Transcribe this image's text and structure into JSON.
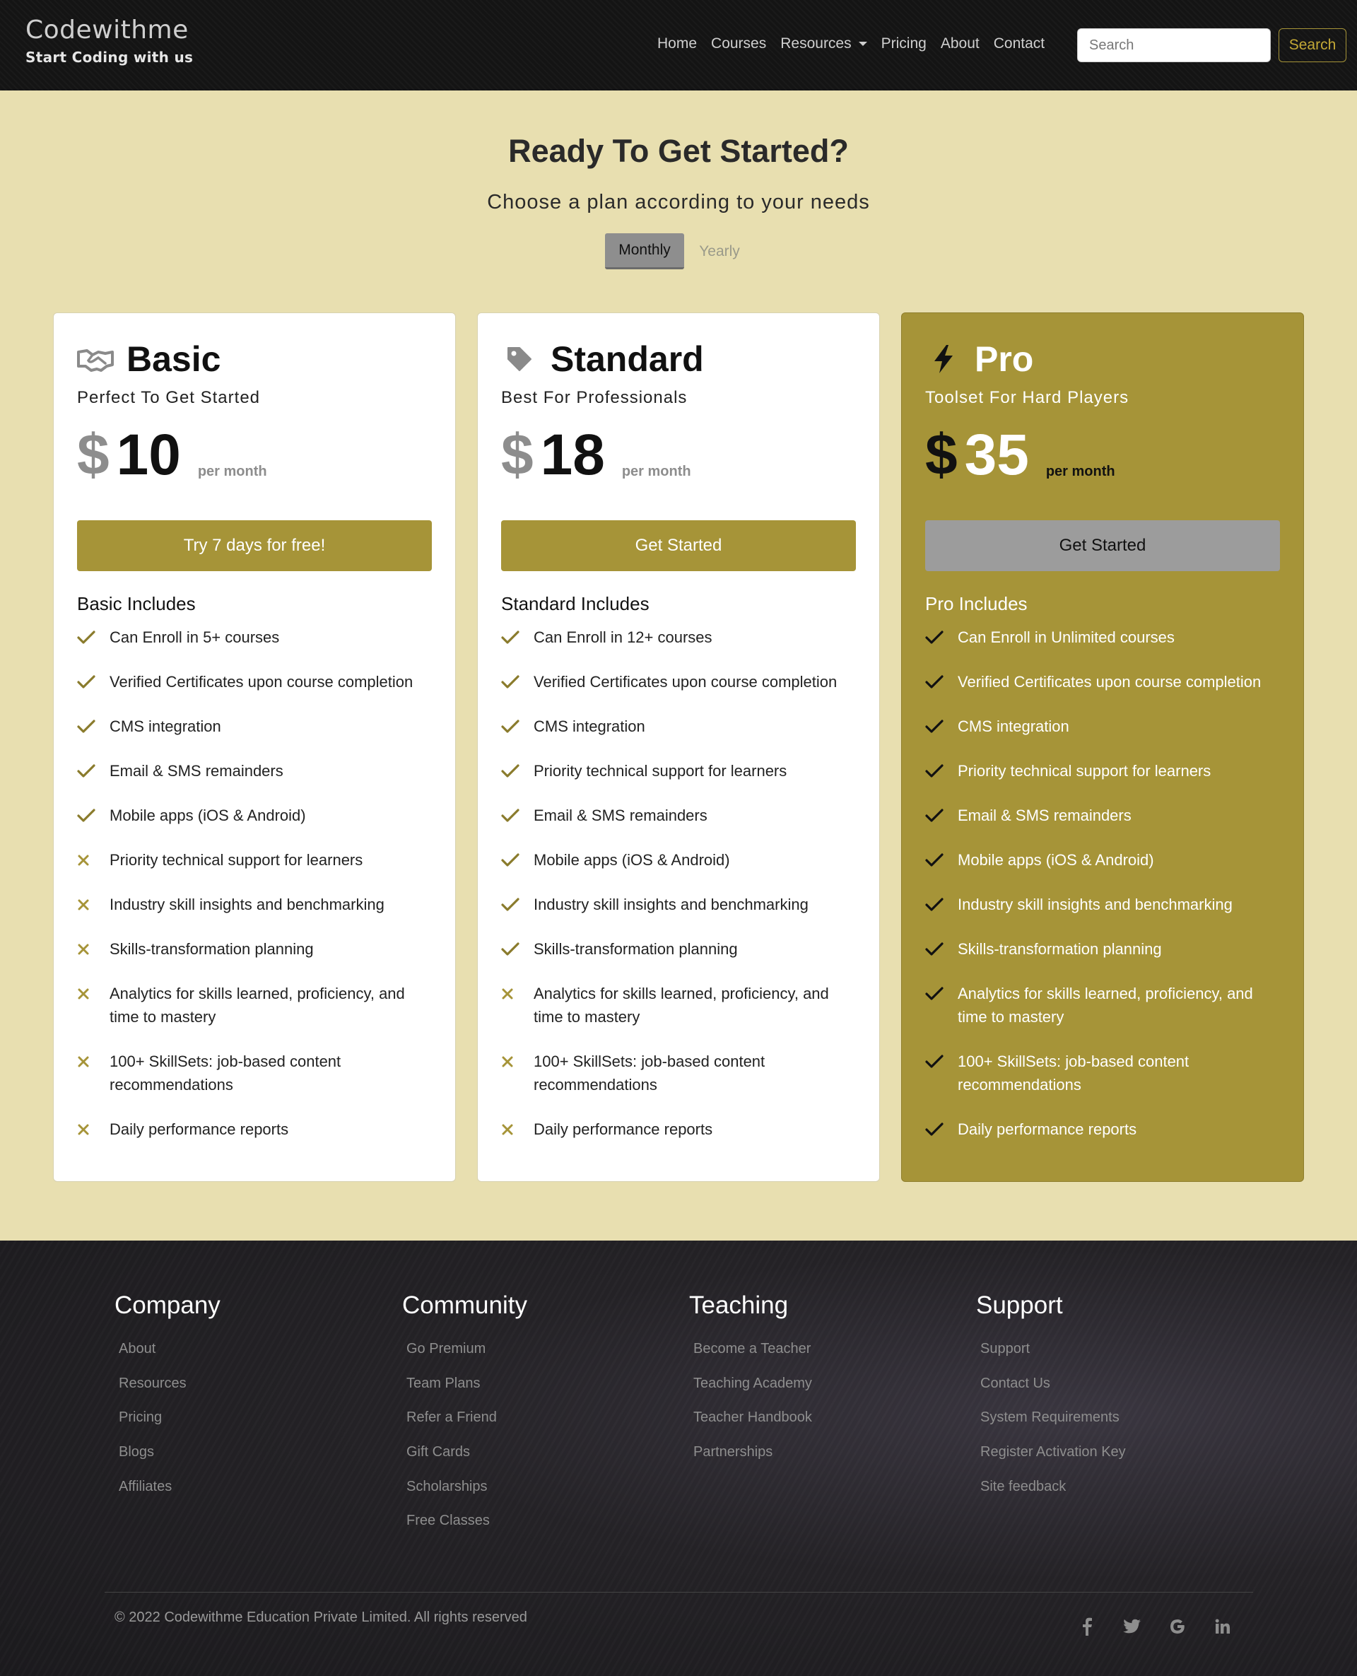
{
  "brand": {
    "name": "Codewithme",
    "tagline": "Start Coding with us"
  },
  "nav": {
    "items": [
      {
        "label": "Home"
      },
      {
        "label": "Courses"
      },
      {
        "label": "Resources"
      },
      {
        "label": "Pricing"
      },
      {
        "label": "About"
      },
      {
        "label": "Contact"
      }
    ],
    "search_placeholder": "Search",
    "search_button": "Search"
  },
  "hero": {
    "title": "Ready To Get Started?",
    "subtitle": "Choose a plan according to your needs",
    "toggle": {
      "monthly": "Monthly",
      "yearly": "Yearly",
      "selected": "Monthly"
    }
  },
  "plans": [
    {
      "name": "Basic",
      "icon": "handshake-icon",
      "tagline": "Perfect To Get Started",
      "currency": "$",
      "price": "10",
      "period": "per month",
      "cta": "Try 7 days for free!",
      "includes_title": "Basic Includes",
      "features": [
        {
          "text": "Can Enroll in 5+ courses",
          "included": true
        },
        {
          "text": "Verified Certificates upon course completion",
          "included": true
        },
        {
          "text": "CMS integration",
          "included": true
        },
        {
          "text": "Email & SMS remainders",
          "included": true
        },
        {
          "text": "Mobile apps (iOS & Android)",
          "included": true
        },
        {
          "text": "Priority technical support for learners",
          "included": false
        },
        {
          "text": "Industry skill insights and benchmarking",
          "included": false
        },
        {
          "text": "Skills-transformation planning",
          "included": false
        },
        {
          "text": "Analytics for skills learned, proficiency, and time to mastery",
          "included": false
        },
        {
          "text": "100+ SkillSets: job-based content recommendations",
          "included": false
        },
        {
          "text": "Daily performance reports",
          "included": false
        }
      ]
    },
    {
      "name": "Standard",
      "icon": "tag-icon",
      "tagline": "Best For Professionals",
      "currency": "$",
      "price": "18",
      "period": "per month",
      "cta": "Get Started",
      "includes_title": "Standard Includes",
      "features": [
        {
          "text": "Can Enroll in 12+ courses",
          "included": true
        },
        {
          "text": "Verified Certificates upon course completion",
          "included": true
        },
        {
          "text": "CMS integration",
          "included": true
        },
        {
          "text": "Priority technical support for learners",
          "included": true
        },
        {
          "text": "Email & SMS remainders",
          "included": true
        },
        {
          "text": "Mobile apps (iOS & Android)",
          "included": true
        },
        {
          "text": "Industry skill insights and benchmarking",
          "included": true
        },
        {
          "text": "Skills-transformation planning",
          "included": true
        },
        {
          "text": "Analytics for skills learned, proficiency, and time to mastery",
          "included": false
        },
        {
          "text": "100+ SkillSets: job-based content recommendations",
          "included": false
        },
        {
          "text": "Daily performance reports",
          "included": false
        }
      ]
    },
    {
      "name": "Pro",
      "icon": "bolt-icon",
      "tagline": "Toolset For Hard Players",
      "currency": "$",
      "price": "35",
      "period": "per month",
      "cta": "Get Started",
      "includes_title": "Pro Includes",
      "features": [
        {
          "text": "Can Enroll in Unlimited courses",
          "included": true
        },
        {
          "text": "Verified Certificates upon course completion",
          "included": true
        },
        {
          "text": "CMS integration",
          "included": true
        },
        {
          "text": "Priority technical support for learners",
          "included": true
        },
        {
          "text": "Email & SMS remainders",
          "included": true
        },
        {
          "text": "Mobile apps (iOS & Android)",
          "included": true
        },
        {
          "text": "Industry skill insights and benchmarking",
          "included": true
        },
        {
          "text": "Skills-transformation planning",
          "included": true
        },
        {
          "text": "Analytics for skills learned, proficiency, and time to mastery",
          "included": true
        },
        {
          "text": "100+ SkillSets: job-based content recommendations",
          "included": true
        },
        {
          "text": "Daily performance reports",
          "included": true
        }
      ]
    }
  ],
  "footer": {
    "columns": [
      {
        "title": "Company",
        "links": [
          "About",
          "Resources",
          "Pricing",
          "Blogs",
          "Affiliates"
        ]
      },
      {
        "title": "Community",
        "links": [
          "Go Premium",
          "Team Plans",
          "Refer a Friend",
          "Gift Cards",
          "Scholarships",
          "Free Classes"
        ]
      },
      {
        "title": "Teaching",
        "links": [
          "Become a Teacher",
          "Teaching Academy",
          "Teacher Handbook",
          "Partnerships"
        ]
      },
      {
        "title": "Support",
        "links": [
          "Support",
          "Contact Us",
          "System Requirements",
          "Register Activation Key",
          "Site feedback"
        ]
      }
    ],
    "copyright": "© 2022 Codewithme Education Private Limited. All rights reserved",
    "socials": [
      "facebook-icon",
      "twitter-icon",
      "google-icon",
      "linkedin-icon"
    ]
  },
  "colors": {
    "accent": "#a69438",
    "page_bg": "#e8dfb0",
    "nav_bg": "#141414",
    "footer_bg": "#1f1d21",
    "included_check": "#8a7b2c",
    "excluded_x": "#a69438",
    "pro_card_bg": "#a69438"
  }
}
